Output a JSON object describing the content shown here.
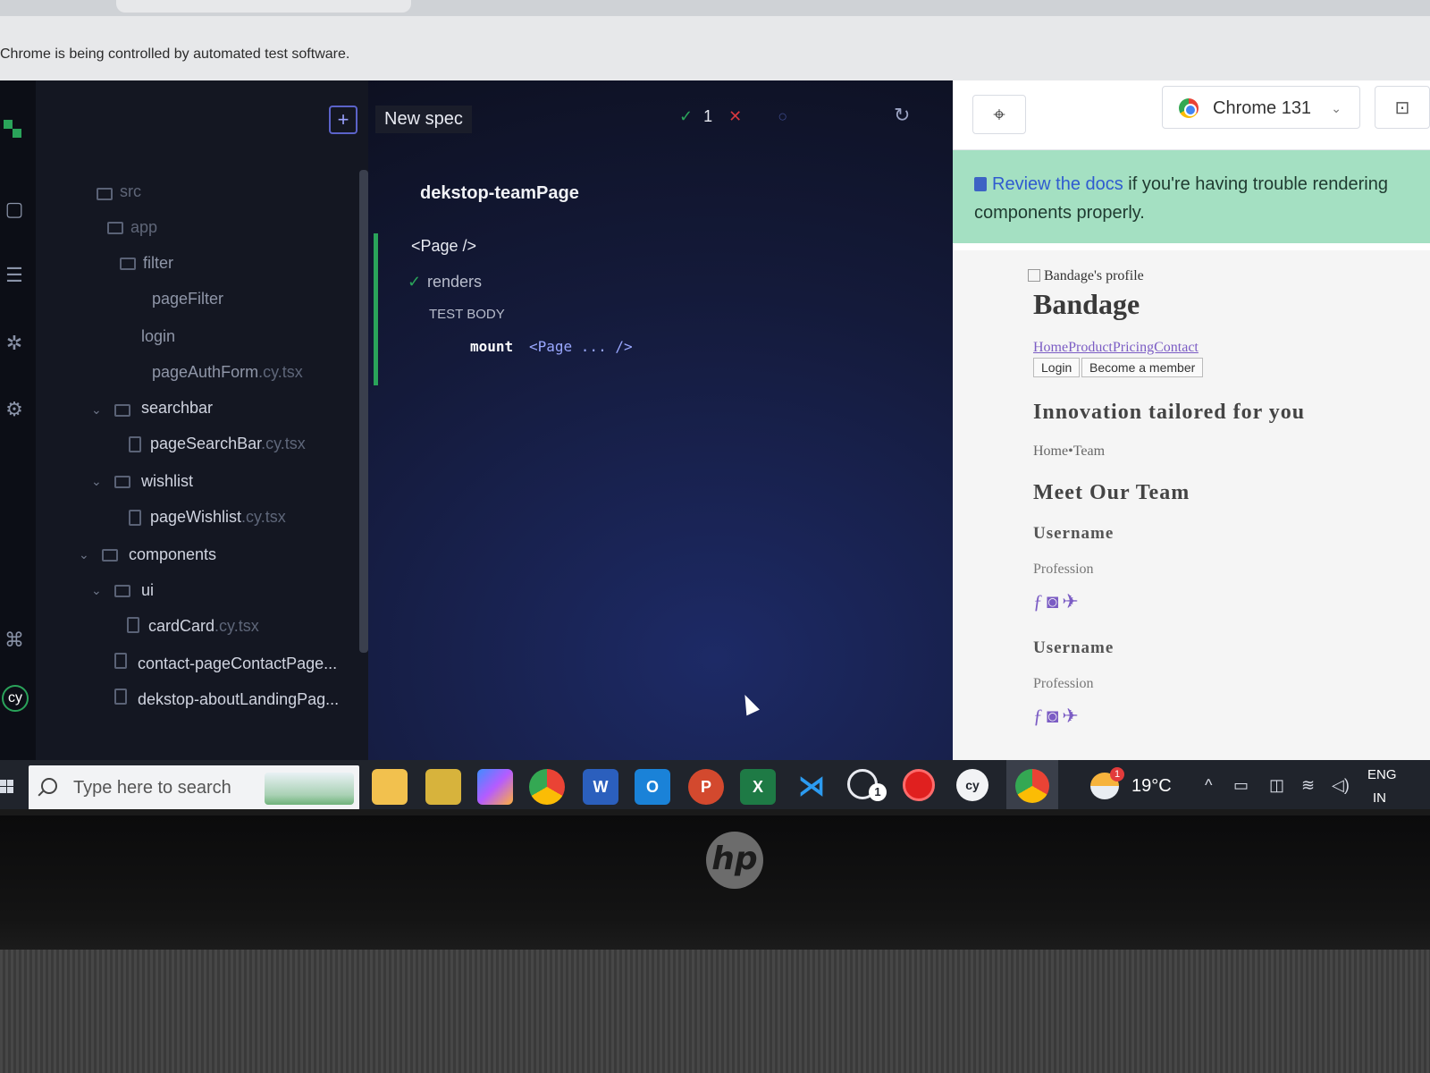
{
  "browser": {
    "automation_banner": "Chrome is being controlled by automated test software."
  },
  "runner": {
    "new_spec_label": "New spec",
    "stats": {
      "passed": "1"
    },
    "spec_title": "dekstop-teamPage",
    "suite_title": "<Page />",
    "test_title": "renders",
    "body_label": "TEST BODY",
    "command": {
      "name": "mount",
      "message": "<Page ... />"
    }
  },
  "spec_tree": {
    "items": [
      {
        "label": "src"
      },
      {
        "label": "app"
      },
      {
        "label": "filter"
      },
      {
        "label": "pageFilter"
      },
      {
        "label": "login"
      },
      {
        "label": "pageAuthForm",
        "ext": ".cy.tsx"
      },
      {
        "label": "searchbar"
      },
      {
        "label": "pageSearchBar",
        "ext": ".cy.tsx"
      },
      {
        "label": "wishlist"
      },
      {
        "label": "pageWishlist",
        "ext": ".cy.tsx"
      },
      {
        "label": "components"
      },
      {
        "label": "ui"
      },
      {
        "label": "cardCard",
        "ext": ".cy.tsx"
      },
      {
        "label": "contact-pageContactPage..."
      },
      {
        "label": "dekstop-aboutLandingPag..."
      }
    ]
  },
  "aut_header": {
    "browser_label": "Chrome 131"
  },
  "docs_banner": {
    "link": "Review the docs",
    "text": " if you're having trouble rendering components properly."
  },
  "aut_page": {
    "broken_image_alt": "Bandage's profile",
    "brand": "Bandage",
    "nav_links": "HomeProductPricingContact",
    "login": "Login",
    "become_member": "Become a member",
    "hero_title": "Innovation tailored for you",
    "breadcrumb": "Home•Team",
    "team_title": "Meet Our Team",
    "members": [
      {
        "name": "Username",
        "profession": "Profession"
      },
      {
        "name": "Username",
        "profession": "Profession"
      }
    ],
    "social_icons": [
      "facebook-icon",
      "instagram-icon",
      "twitter-icon"
    ]
  },
  "taskbar": {
    "search_placeholder": "Type here to search",
    "whatsapp_badge": "1",
    "weather_badge": "1",
    "temperature": "19°C",
    "lang_line1": "ENG",
    "lang_line2": "IN"
  },
  "colors": {
    "pass": "#2aa35a",
    "fail": "#d6383e",
    "docs_banner_bg": "#a4e0c2",
    "accent": "#5b63c9"
  }
}
